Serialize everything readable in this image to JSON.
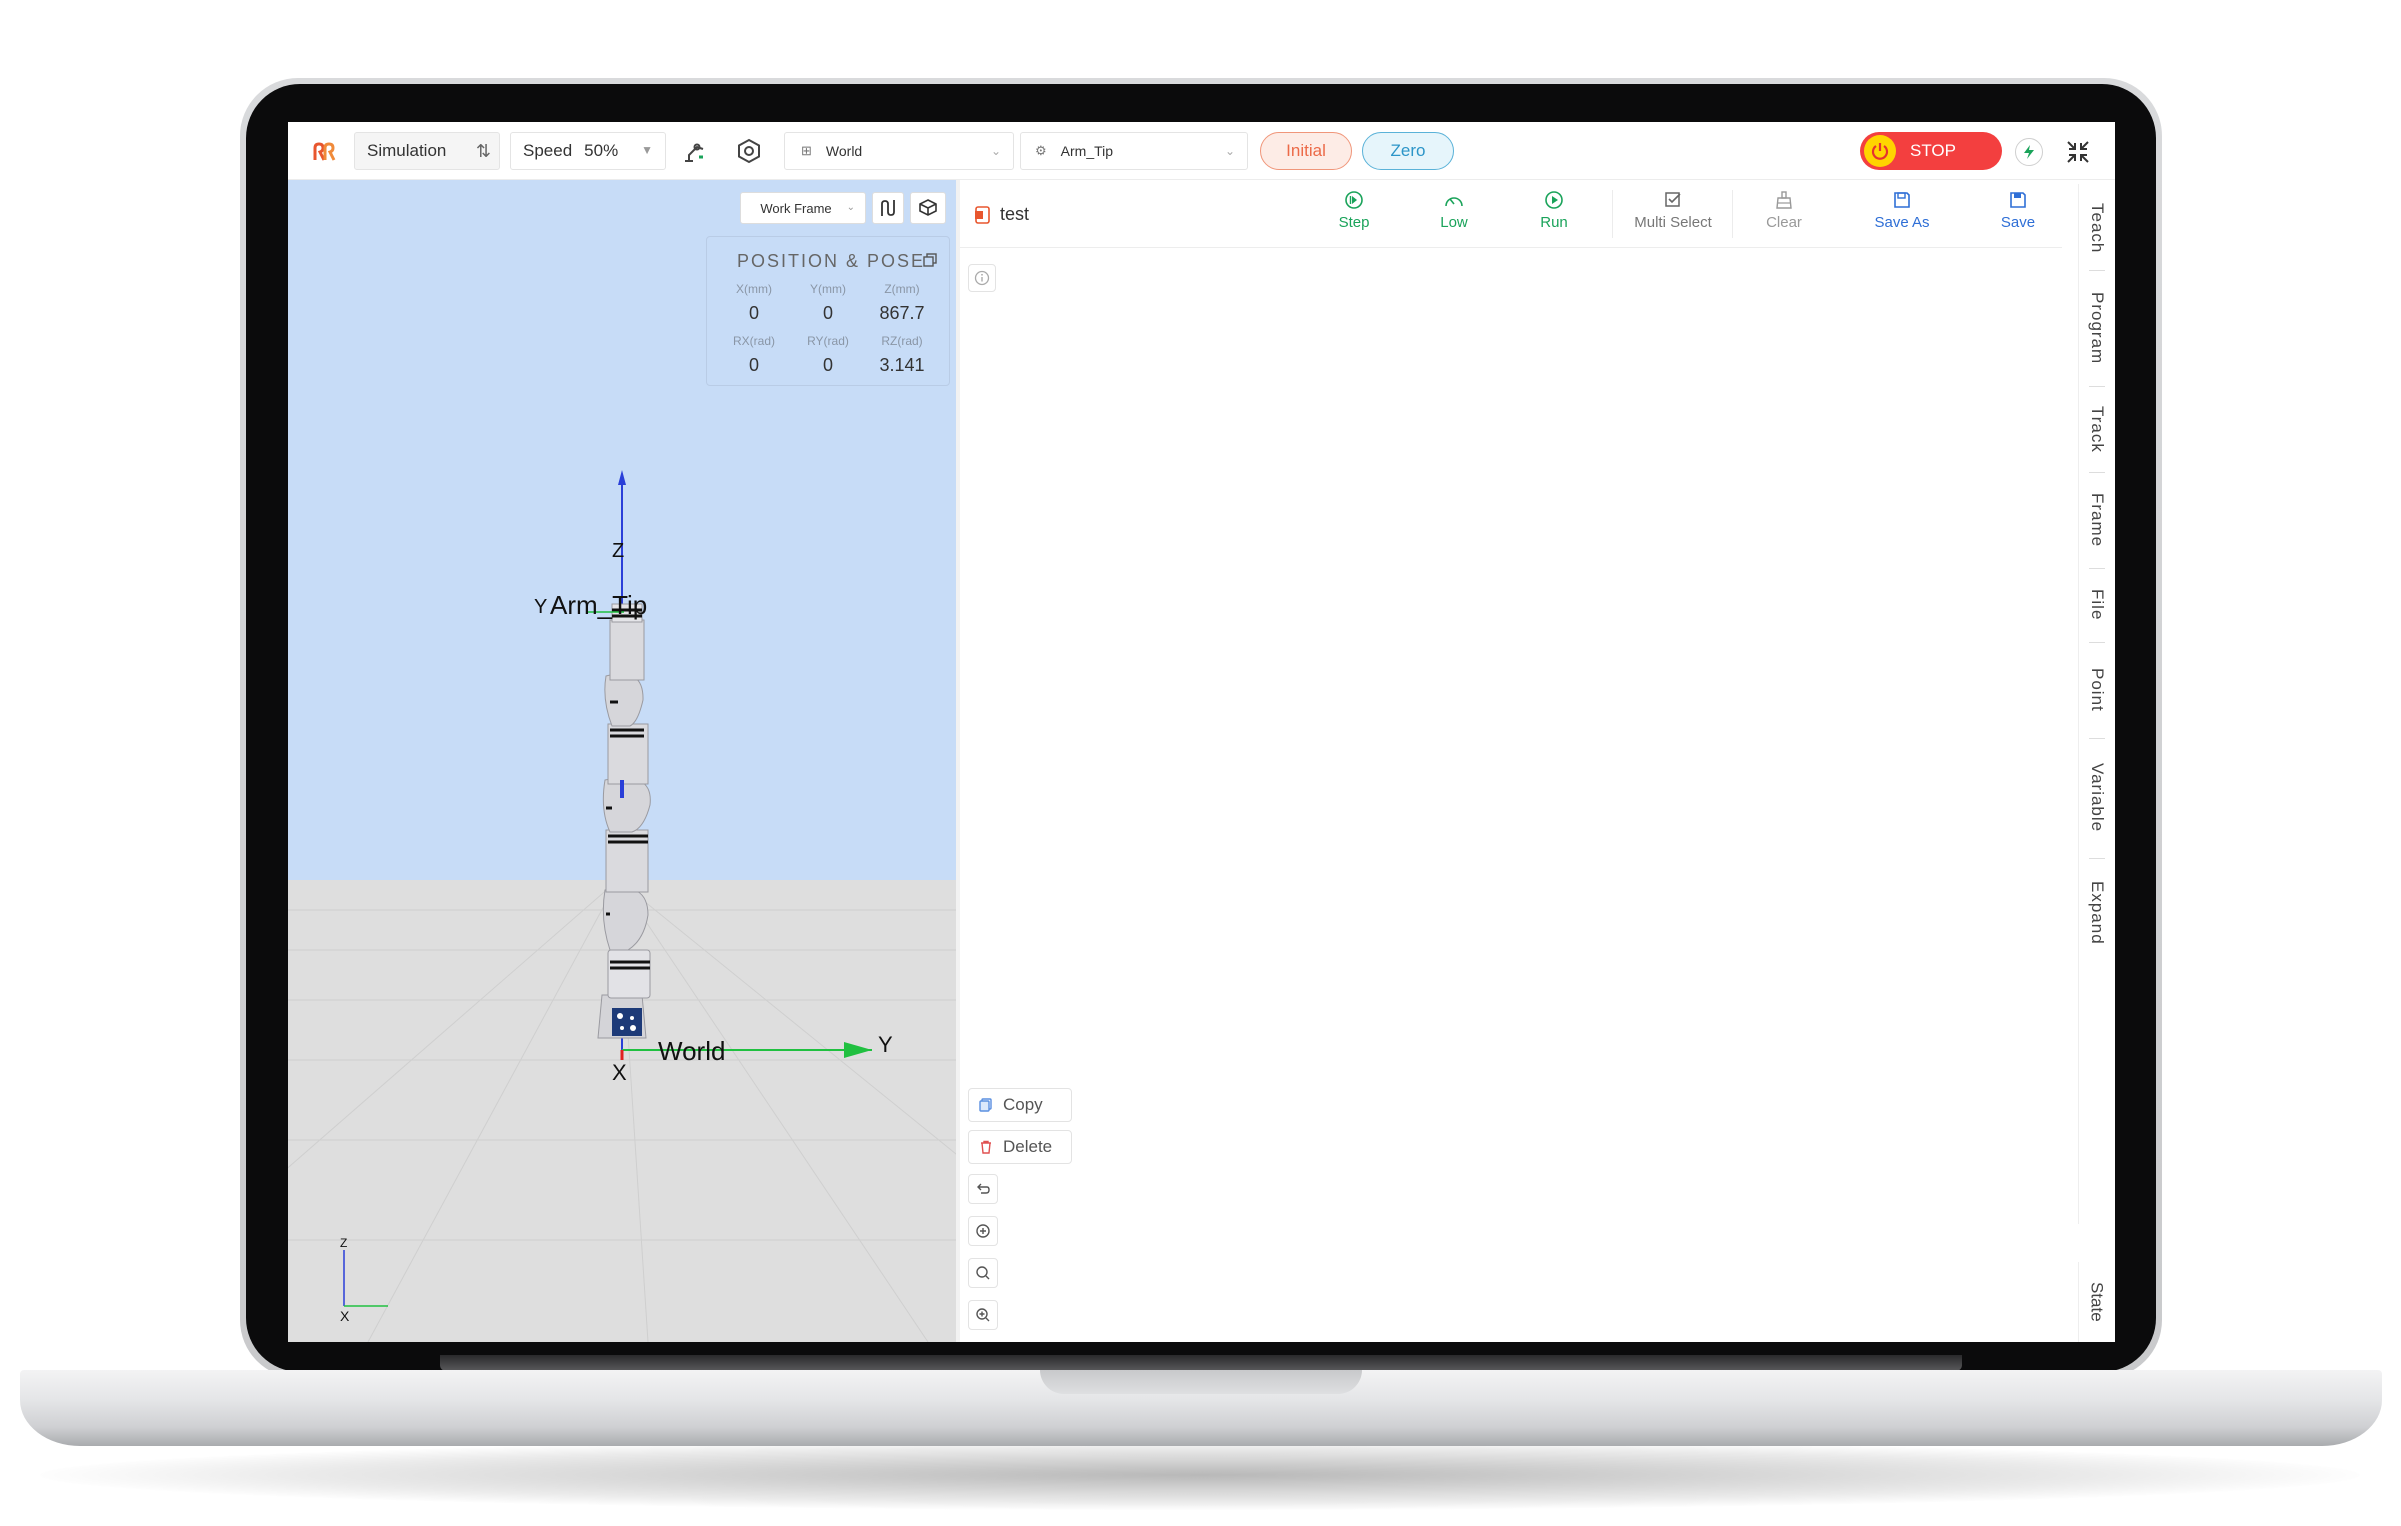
{
  "toolbar": {
    "mode_label": "Simulation",
    "speed_label": "Speed",
    "speed_value": "50%",
    "frame_select": "World",
    "tool_select": "Arm_Tip",
    "initial_label": "Initial",
    "zero_label": "Zero",
    "stop_label": "STOP"
  },
  "viewport": {
    "frame_select": "Work Frame",
    "pose": {
      "title": "POSITION & POSE",
      "x_label": "X(mm)",
      "y_label": "Y(mm)",
      "z_label": "Z(mm)",
      "x": "0",
      "y": "0",
      "z": "867.7",
      "rx_label": "RX(rad)",
      "ry_label": "RY(rad)",
      "rz_label": "RZ(rad)",
      "rx": "0",
      "ry": "0",
      "rz": "3.141"
    },
    "labels": {
      "axis_z": "Z",
      "axis_y_top": "Y",
      "tool_frame": "Arm_Tip",
      "world_frame": "World",
      "axis_y": "Y",
      "axis_x": "X",
      "mini_z": "Z",
      "mini_x": "X"
    }
  },
  "program": {
    "file_name": "test",
    "buttons": {
      "step": "Step",
      "low": "Low",
      "run": "Run",
      "multi_select": "Multi Select",
      "clear": "Clear",
      "save_as": "Save As",
      "save": "Save"
    },
    "actions": {
      "copy": "Copy",
      "delete": "Delete"
    }
  },
  "right_tabs": [
    "Teach",
    "Program",
    "Track",
    "Frame",
    "File",
    "Point",
    "Variable",
    "Expand"
  ],
  "state_tab": "State",
  "colors": {
    "green": "#1aa35a",
    "blue": "#2f6fd6",
    "stop_red": "#f33f3f",
    "sky": "#c7dcf7"
  }
}
